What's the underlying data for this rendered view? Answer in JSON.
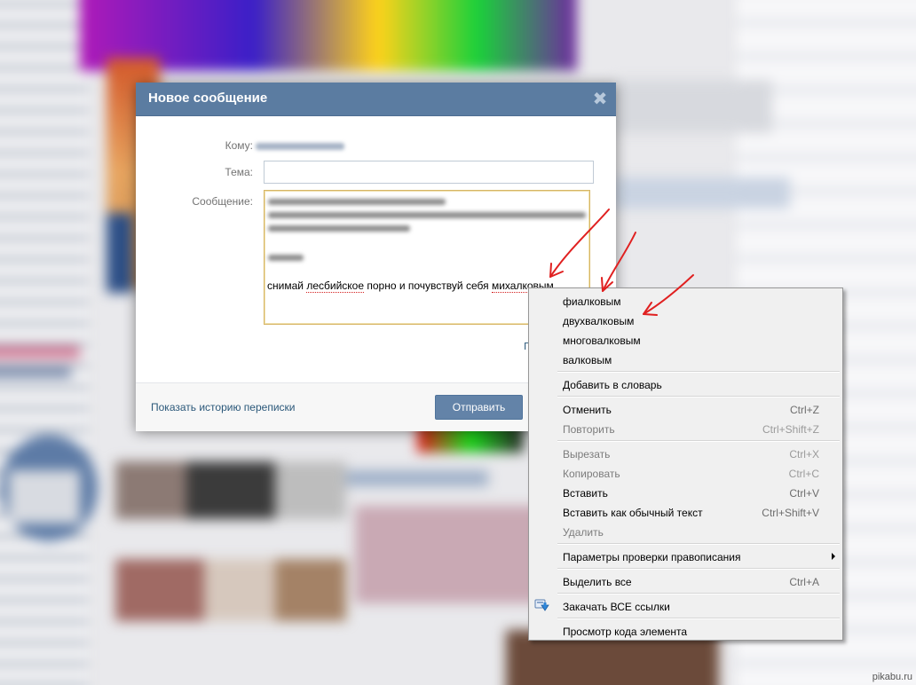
{
  "dialog": {
    "title": "Новое сообщение",
    "close_glyph": "✖",
    "to_label": "Кому:",
    "subject_label": "Тема:",
    "subject_value": "",
    "message_label": "Сообщение:",
    "message_words": [
      "снимай",
      "лесбийское",
      "порно",
      "и",
      "почувствуй",
      "себя",
      "михалковым"
    ],
    "history_link": "Показать историю переписки",
    "send_label": "Отправить",
    "partial_char": "П"
  },
  "context_menu": {
    "suggestions": [
      "фиалковым",
      "двухвалковым",
      "многовалковым",
      "валковым"
    ],
    "add_to_dictionary": "Добавить в словарь",
    "edit_items": [
      {
        "label": "Отменить",
        "shortcut": "Ctrl+Z",
        "enabled": true
      },
      {
        "label": "Повторить",
        "shortcut": "Ctrl+Shift+Z",
        "enabled": false
      }
    ],
    "clipboard_items": [
      {
        "label": "Вырезать",
        "shortcut": "Ctrl+X",
        "enabled": false
      },
      {
        "label": "Копировать",
        "shortcut": "Ctrl+C",
        "enabled": false
      },
      {
        "label": "Вставить",
        "shortcut": "Ctrl+V",
        "enabled": true
      },
      {
        "label": "Вставить как обычный текст",
        "shortcut": "Ctrl+Shift+V",
        "enabled": true
      },
      {
        "label": "Удалить",
        "shortcut": "",
        "enabled": false
      }
    ],
    "spellcheck_options": "Параметры проверки правописания",
    "select_all": {
      "label": "Выделить все",
      "shortcut": "Ctrl+A"
    },
    "download_all": "Закачать ВСЕ ссылки",
    "inspect": "Просмотр кода элемента"
  },
  "watermark": "pikabu.ru",
  "colors": {
    "header": "#5b7ca1",
    "link": "#2b587a",
    "annotation": "#e02020",
    "focus_border": "#d7b665"
  }
}
